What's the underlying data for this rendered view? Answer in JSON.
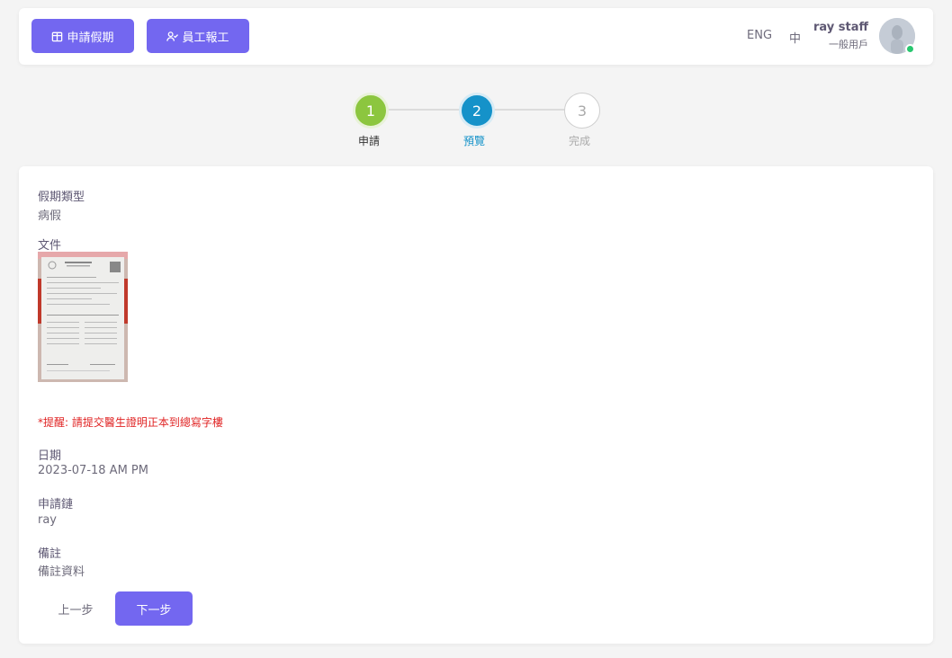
{
  "header": {
    "apply_leave_label": "申請假期",
    "staff_report_label": "員工報工",
    "lang_en": "ENG",
    "lang_zh": "中",
    "user_name": "ray staff",
    "user_role": "一般用戶"
  },
  "stepper": {
    "steps": [
      {
        "number": "1",
        "label": "申請",
        "state": "done",
        "color": "#8cc63f"
      },
      {
        "number": "2",
        "label": "預覽",
        "state": "active",
        "color": "#1592c9"
      },
      {
        "number": "3",
        "label": "完成",
        "state": "pending",
        "color": "#bbbbbb"
      }
    ]
  },
  "details": {
    "leave_type_label": "假期類型",
    "leave_type_value": "病假",
    "document_label": "文件",
    "reminder": "*提醒: 請提交醫生證明正本到總寫字樓",
    "date_label": "日期",
    "date_value": "2023-07-18 AM PM",
    "applicant_label": "申請鏈",
    "applicant_value": "ray",
    "remarks_label": "備註",
    "remarks_value": "備註資料"
  },
  "actions": {
    "prev_label": "上一步",
    "next_label": "下一步"
  },
  "colors": {
    "accent": "#7367f0",
    "reminder": "#e02424",
    "online": "#28c76f"
  }
}
